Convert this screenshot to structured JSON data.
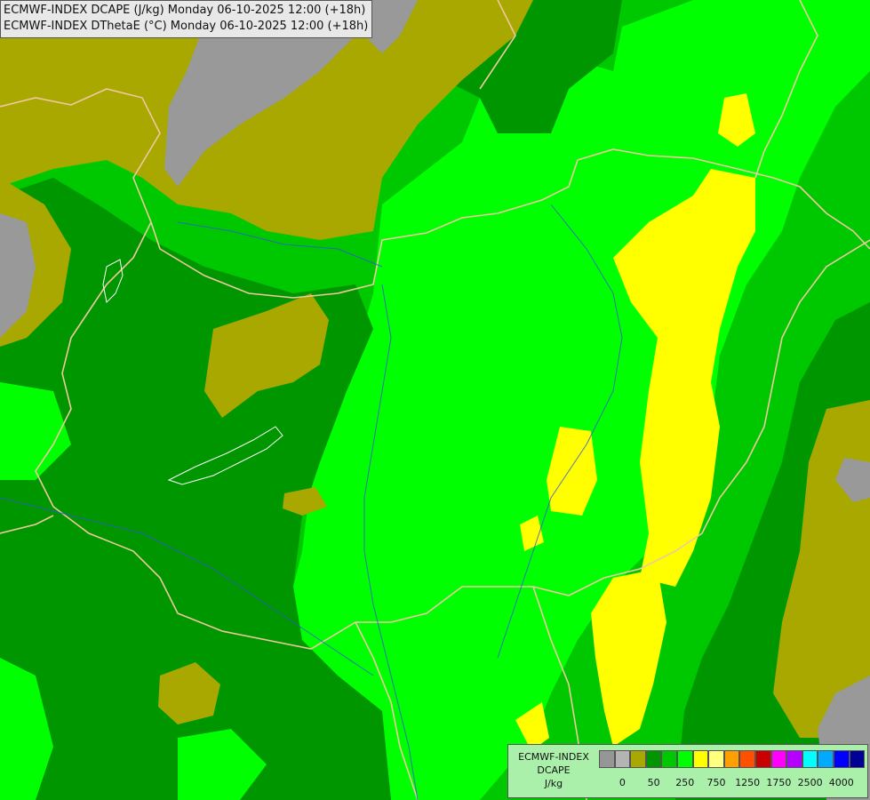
{
  "titles": [
    "ECMWF-INDEX DCAPE (J/kg) Monday 06-10-2025 12:00 (+18h)",
    "ECMWF-INDEX DThetaE (°C) Monday 06-10-2025 12:00 (+18h)"
  ],
  "legend": {
    "line1": "ECMWF-INDEX",
    "line2": "DCAPE",
    "line3": "J/kg",
    "colors": [
      "#969696",
      "#b4b4b4",
      "#a8a800",
      "#009600",
      "#00c800",
      "#00ff00",
      "#ffff00",
      "#ffff80",
      "#ffa000",
      "#ff5000",
      "#c80000",
      "#ff00ff",
      "#b400ff",
      "#00ffff",
      "#00aaff",
      "#0000ff",
      "#000096"
    ],
    "ticks": [
      "0",
      "50",
      "250",
      "750",
      "1250",
      "1750",
      "2500",
      "4000"
    ]
  },
  "colors": {
    "gray": "#999999",
    "olive": "#a8a800",
    "dark_green": "#009900",
    "mid_green": "#33cc33",
    "light_green": "#00ff00",
    "yellow": "#ffff00",
    "border_line": "#f0c8a0",
    "river_line": "#3355dd"
  }
}
